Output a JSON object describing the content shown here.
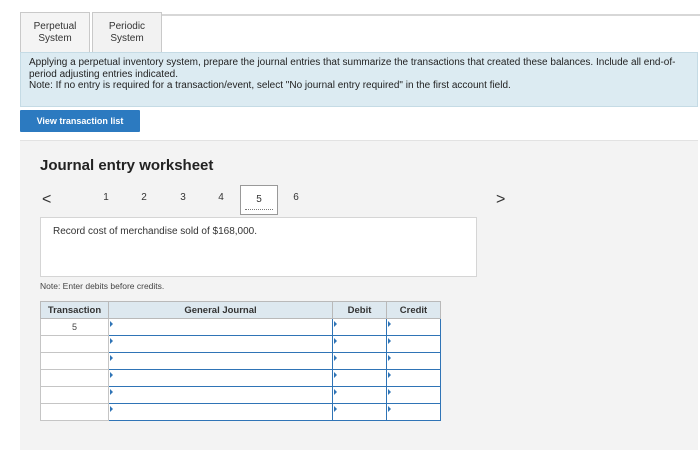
{
  "tabs": [
    {
      "label": "Perpetual\nSystem",
      "active": true
    },
    {
      "label": "Periodic\nSystem",
      "active": false
    }
  ],
  "instructions": {
    "line1": "Applying a perpetual inventory system, prepare the journal entries that summarize the transactions that created these balances. Include all end-of-period adjusting entries indicated.",
    "line2": "Note: If no entry is required for a transaction/event, select \"No journal entry required\" in the first account field."
  },
  "view_button": "View transaction list",
  "worksheet": {
    "title": "Journal entry worksheet",
    "pages": [
      "1",
      "2",
      "3",
      "4",
      "5",
      "6"
    ],
    "current_page": "5",
    "prev_symbol": "<",
    "next_symbol": ">",
    "description": "Record cost of merchandise sold of $168,000.",
    "note": "Note: Enter debits before credits."
  },
  "table": {
    "headers": [
      "Transaction",
      "General Journal",
      "Debit",
      "Credit"
    ],
    "rows": [
      {
        "transaction": "5"
      },
      {
        "transaction": ""
      },
      {
        "transaction": ""
      },
      {
        "transaction": ""
      },
      {
        "transaction": ""
      },
      {
        "transaction": ""
      }
    ]
  }
}
